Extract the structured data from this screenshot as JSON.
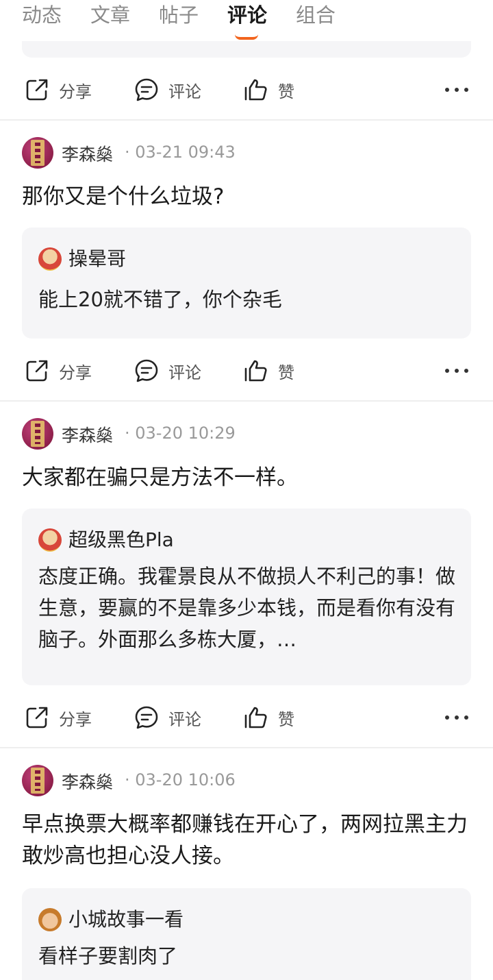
{
  "tabs": [
    "动态",
    "文章",
    "帖子",
    "评论",
    "组合"
  ],
  "active_tab": "评论",
  "actions": {
    "share": "分享",
    "comment": "评论",
    "like": "赞"
  },
  "posts": [
    {
      "author": "李森燊",
      "meta": "· 03-21 09:43",
      "text": "那你又是个什么垃圾?",
      "quote": {
        "name": "操晕哥",
        "text": "能上20就不错了，你个杂毛"
      }
    },
    {
      "author": "李森燊",
      "meta": "· 03-20 10:29",
      "text": "大家都在骗只是方法不一样。",
      "quote": {
        "name": "超级黑色Pla",
        "text": "态度正确。我霍景良从不做损人不利己的事！做生意，要赢的不是靠多少本钱，而是看你有没有脑子。外面那么多栋大厦，…"
      }
    },
    {
      "author": "李森燊",
      "meta": "· 03-20 10:06",
      "text": "早点换票大概率都赚钱在开心了，两网拉黑主力敢炒高也担心没人接。",
      "quote": {
        "name": "小城故事一看",
        "text": "看样子要割肉了"
      }
    }
  ]
}
